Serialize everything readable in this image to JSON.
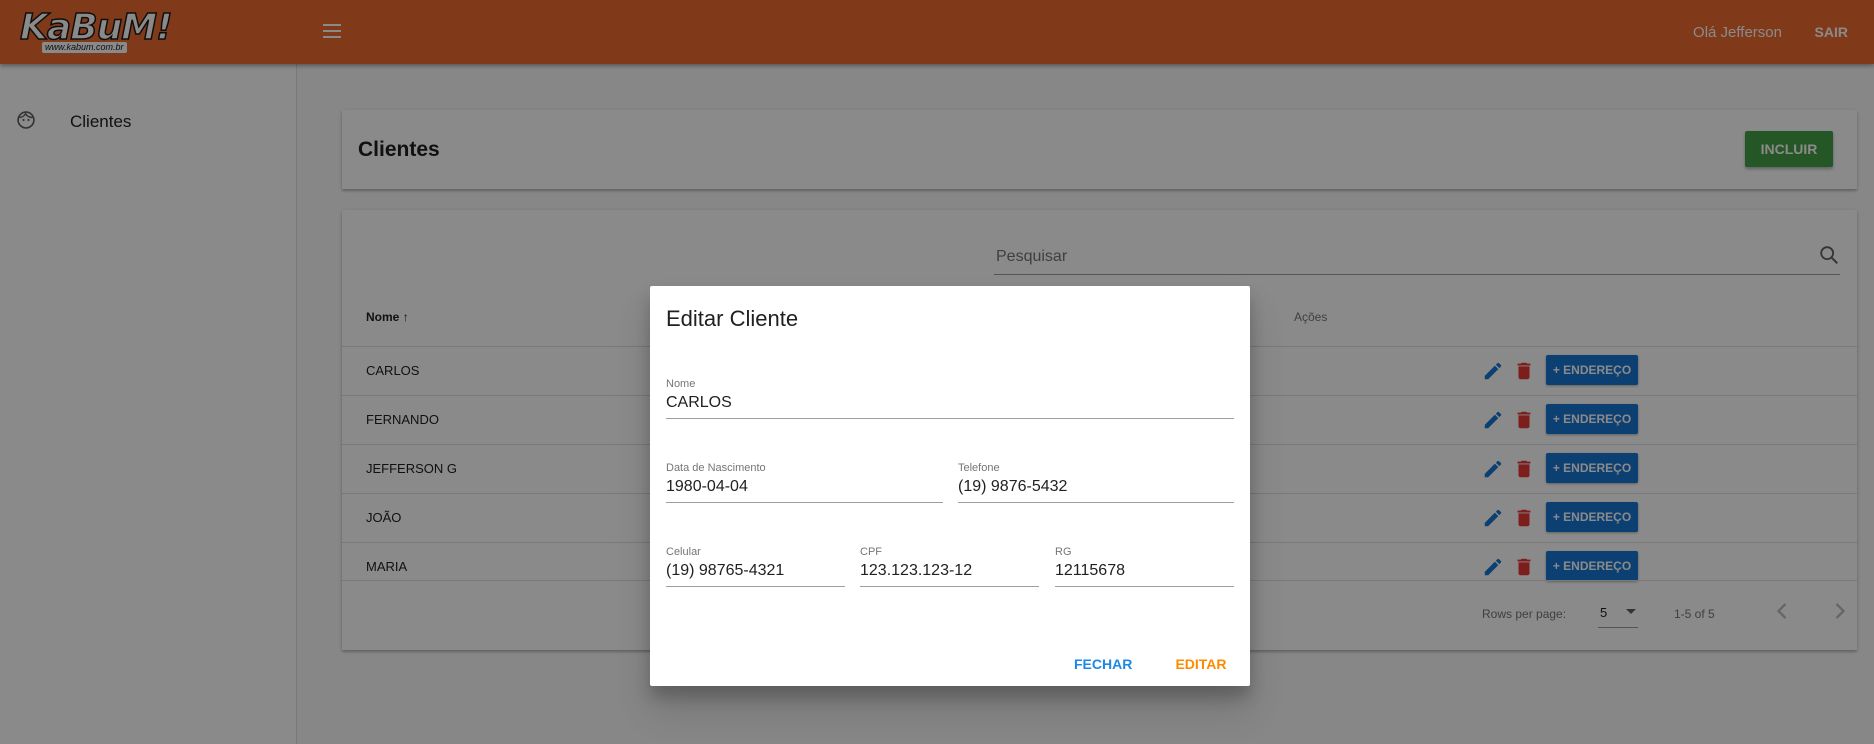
{
  "header": {
    "logo_text": "KaBuM!",
    "logo_sub": "www.kabum.com.br",
    "greeting": "Olá Jefferson",
    "logout_label": "SAIR"
  },
  "sidebar": {
    "items": [
      {
        "label": "Clientes",
        "icon": "face-icon"
      }
    ]
  },
  "page": {
    "title": "Clientes",
    "add_button": "INCLUIR"
  },
  "table": {
    "search_placeholder": "Pesquisar",
    "columns": {
      "name": "Nome",
      "actions": "Ações"
    },
    "rows": [
      {
        "name": "CARLOS",
        "address_button": "+ ENDEREÇO"
      },
      {
        "name": "FERNANDO",
        "address_button": "+ ENDEREÇO"
      },
      {
        "name": "JEFFERSON G",
        "address_button": "+ ENDEREÇO"
      },
      {
        "name": "JOÃO",
        "address_button": "+ ENDEREÇO"
      },
      {
        "name": "MARIA",
        "address_button": "+ ENDEREÇO"
      }
    ],
    "footer": {
      "rows_per_page_label": "Rows per page:",
      "rows_per_page_value": "5",
      "range": "1-5 of 5"
    }
  },
  "dialog": {
    "title": "Editar Cliente",
    "fields": {
      "nome": {
        "label": "Nome",
        "value": "CARLOS"
      },
      "data_nascimento": {
        "label": "Data de Nascimento",
        "value": "1980-04-04"
      },
      "telefone": {
        "label": "Telefone",
        "value": "(19) 9876-5432"
      },
      "celular": {
        "label": "Celular",
        "value": "(19) 98765-4321"
      },
      "cpf": {
        "label": "CPF",
        "value": "123.123.123-12"
      },
      "rg": {
        "label": "RG",
        "value": "12115678"
      }
    },
    "close_label": "FECHAR",
    "submit_label": "EDITAR"
  },
  "colors": {
    "header": "#ef6c2f",
    "add_button": "#43a047",
    "address_button": "#1976d2",
    "edit_icon": "#1976d2",
    "delete_icon": "#e53935",
    "close_text": "#1e88e5",
    "submit_text": "#fb8c00"
  }
}
